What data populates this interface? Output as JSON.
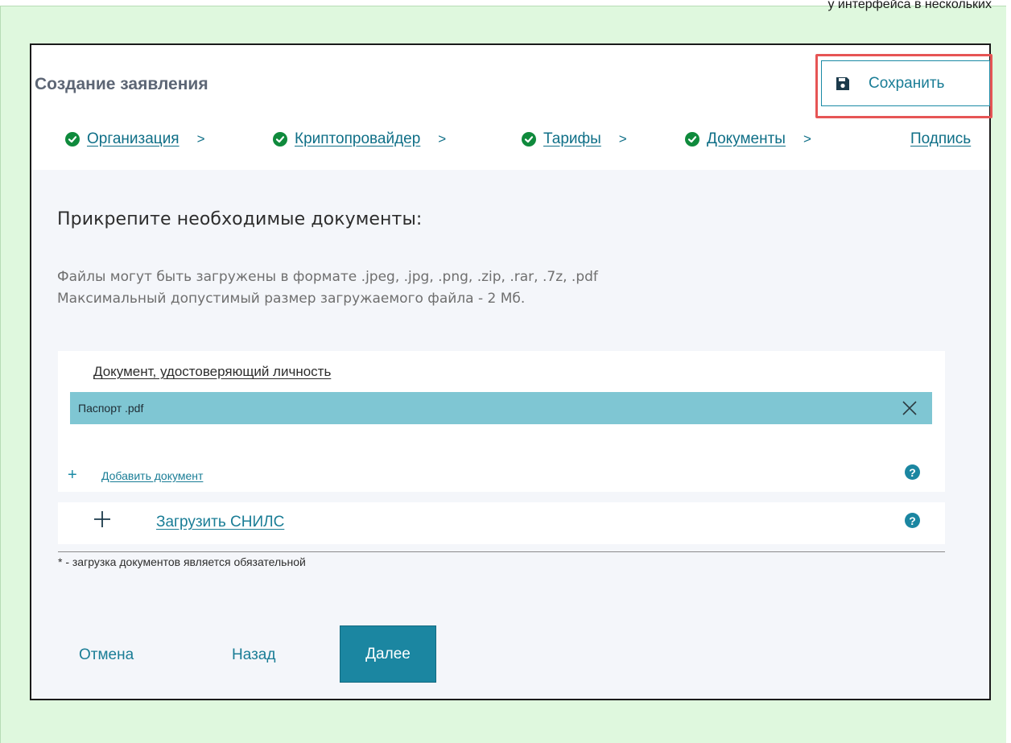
{
  "background": {
    "top_cut_text": "у интерфейса в нескольких"
  },
  "dialog": {
    "title": "Создание заявления",
    "save_button": {
      "label": "Сохранить",
      "icon": "save-icon"
    },
    "steps": [
      {
        "label": "Организация",
        "completed": true
      },
      {
        "label": "Криптопровайдер",
        "completed": true
      },
      {
        "label": "Тарифы",
        "completed": true
      },
      {
        "label": "Документы",
        "completed": true
      },
      {
        "label": "Подпись",
        "completed": false
      }
    ],
    "step_separator": ">",
    "section_title": "Прикрепите необходимые документы:",
    "info_lines": [
      "Файлы могут быть загружены в формате .jpeg, .jpg, .png, .zip, .rar, .7z, .pdf",
      "Максимальный допустимый размер загружаемого файла - 2 Мб."
    ],
    "document_card": {
      "title": "Документ, удостоверяющий личность",
      "file_name": "Паспорт .pdf",
      "add_label": "Добавить документ",
      "add_symbol": "+",
      "help_symbol": "?"
    },
    "snils_card": {
      "label": "Загрузить СНИЛС",
      "help_symbol": "?"
    },
    "required_note": "* - загрузка документов является обязательной",
    "footer": {
      "cancel_label": "Отмена",
      "back_label": "Назад",
      "next_label": "Далее"
    }
  },
  "colors": {
    "backdrop": "#dff8de",
    "accent": "#1b86a1",
    "file_row": "#7fc6d3",
    "highlight": "#e65555",
    "check": "#0f8a3c"
  }
}
